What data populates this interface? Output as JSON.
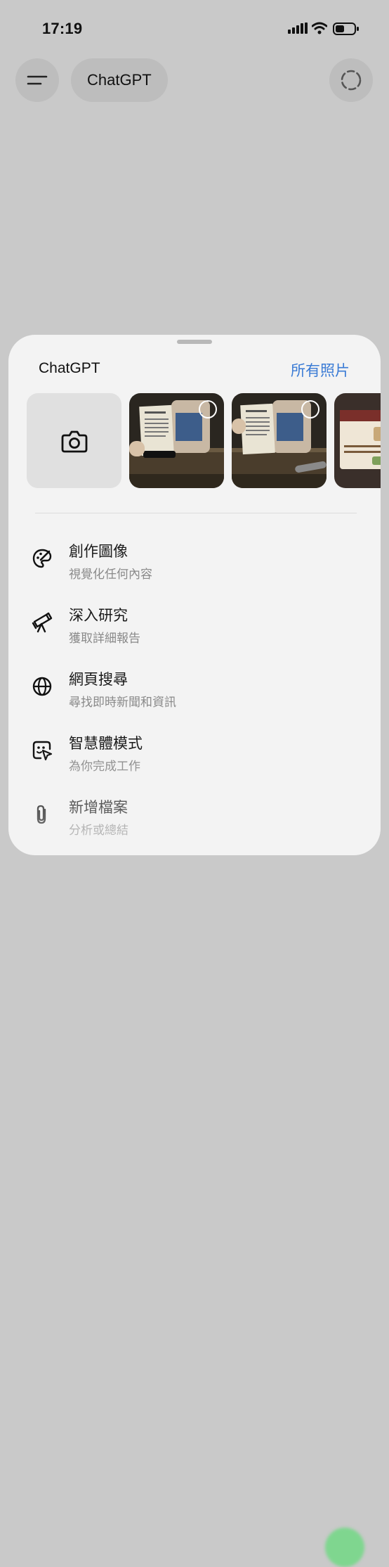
{
  "status_bar": {
    "time": "17:19"
  },
  "header": {
    "title": "ChatGPT"
  },
  "sheet": {
    "title": "ChatGPT",
    "all_photos_label": "所有照片",
    "menu": [
      {
        "label": "創作圖像",
        "sub": "視覺化任何內容",
        "icon": "palette-icon"
      },
      {
        "label": "深入研究",
        "sub": "獲取詳細報告",
        "icon": "telescope-icon"
      },
      {
        "label": "網頁搜尋",
        "sub": "尋找即時新聞和資訊",
        "icon": "globe-icon"
      },
      {
        "label": "智慧體模式",
        "sub": "為你完成工作",
        "icon": "agent-cursor-icon"
      },
      {
        "label": "新增檔案",
        "sub": "分析或總結",
        "icon": "paperclip-icon"
      }
    ]
  },
  "colors": {
    "accent": "#3a7bd5",
    "background": "#c9c9c9",
    "sheet": "#f3f3f3"
  }
}
